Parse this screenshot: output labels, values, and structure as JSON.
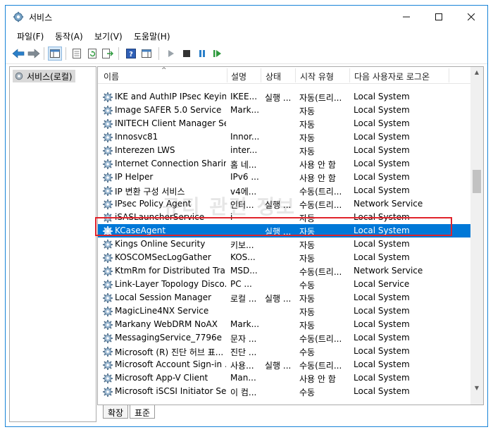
{
  "window": {
    "title": "서비스"
  },
  "menu": [
    {
      "label": "파일(F)"
    },
    {
      "label": "동작(A)"
    },
    {
      "label": "보기(V)"
    },
    {
      "label": "도움말(H)"
    }
  ],
  "tree": {
    "root_label": "서비스(로컬)"
  },
  "columns": {
    "name": "이름",
    "description": "설명",
    "status": "상태",
    "startup": "시작 유형",
    "logon": "다음 사용자로 로그온"
  },
  "rows": [
    {
      "name": "IKE and AuthIP IPsec Keyin...",
      "description": "IKEE...",
      "status": "실행 ...",
      "startup": "자동(트리...",
      "logon": "Local System"
    },
    {
      "name": "Image SAFER 5.0 Service",
      "description": "Mark...",
      "status": "",
      "startup": "자동",
      "logon": "Local System"
    },
    {
      "name": "INITECH Client Manager Se...",
      "description": "",
      "status": "",
      "startup": "자동",
      "logon": "Local System"
    },
    {
      "name": "Innosvc81",
      "description": "Innor...",
      "status": "",
      "startup": "자동",
      "logon": "Local System"
    },
    {
      "name": "Interezen LWS",
      "description": "inter...",
      "status": "",
      "startup": "자동",
      "logon": "Local System"
    },
    {
      "name": "Internet Connection Sharin...",
      "description": "홈 네...",
      "status": "",
      "startup": "사용 안 함",
      "logon": "Local System"
    },
    {
      "name": "IP Helper",
      "description": "IPv6 ...",
      "status": "",
      "startup": "사용 안 함",
      "logon": "Local System"
    },
    {
      "name": "IP 변환 구성 서비스",
      "description": "v4에...",
      "status": "",
      "startup": "수동(트리...",
      "logon": "Local System"
    },
    {
      "name": "IPsec Policy Agent",
      "description": "인터...",
      "status": "실행 ...",
      "startup": "수동(트리...",
      "logon": "Network Service"
    },
    {
      "name": "iSASLauncherService",
      "description": "i",
      "status": "",
      "startup": "자동",
      "logon": "Local System"
    },
    {
      "name": "KCaseAgent",
      "description": "",
      "status": "실행 ...",
      "startup": "자동",
      "logon": "Local System",
      "selected": true
    },
    {
      "name": "Kings Online Security",
      "description": "키보...",
      "status": "",
      "startup": "자동",
      "logon": "Local System"
    },
    {
      "name": "KOSCOMSecLogGather",
      "description": "KOS...",
      "status": "",
      "startup": "자동",
      "logon": "Local System"
    },
    {
      "name": "KtmRm for Distributed Tra...",
      "description": "MSD...",
      "status": "",
      "startup": "수동(트리...",
      "logon": "Network Service"
    },
    {
      "name": "Link-Layer Topology Disco...",
      "description": "PC ...",
      "status": "",
      "startup": "수동",
      "logon": "Local Service"
    },
    {
      "name": "Local Session Manager",
      "description": "로컬 ...",
      "status": "실행 ...",
      "startup": "자동",
      "logon": "Local System"
    },
    {
      "name": "MagicLine4NX Service",
      "description": "",
      "status": "",
      "startup": "자동",
      "logon": "Local System"
    },
    {
      "name": "Markany WebDRM NoAX",
      "description": "Mark...",
      "status": "",
      "startup": "자동",
      "logon": "Local System"
    },
    {
      "name": "MessagingService_7796e",
      "description": "문자 ...",
      "status": "",
      "startup": "수동(트리...",
      "logon": "Local System"
    },
    {
      "name": "Microsoft (R) 진단 허브 표...",
      "description": "진단 ...",
      "status": "",
      "startup": "수동",
      "logon": "Local System"
    },
    {
      "name": "Microsoft Account Sign-in ...",
      "description": "사용...",
      "status": "실행 ...",
      "startup": "수동(트리...",
      "logon": "Local System"
    },
    {
      "name": "Microsoft App-V Client",
      "description": "Man...",
      "status": "",
      "startup": "사용 안 함",
      "logon": "Local System"
    },
    {
      "name": "Microsoft iSCSI Initiator Se...",
      "description": "이 컴...",
      "status": "",
      "startup": "수동",
      "logon": "Local System"
    }
  ],
  "tabs": [
    {
      "label": "확장"
    },
    {
      "label": "표준"
    }
  ],
  "watermark": "규티 관련 정보",
  "colors": {
    "selection": "#0078d7",
    "highlight_border": "#e0232b",
    "window_border": "#1883d7"
  }
}
